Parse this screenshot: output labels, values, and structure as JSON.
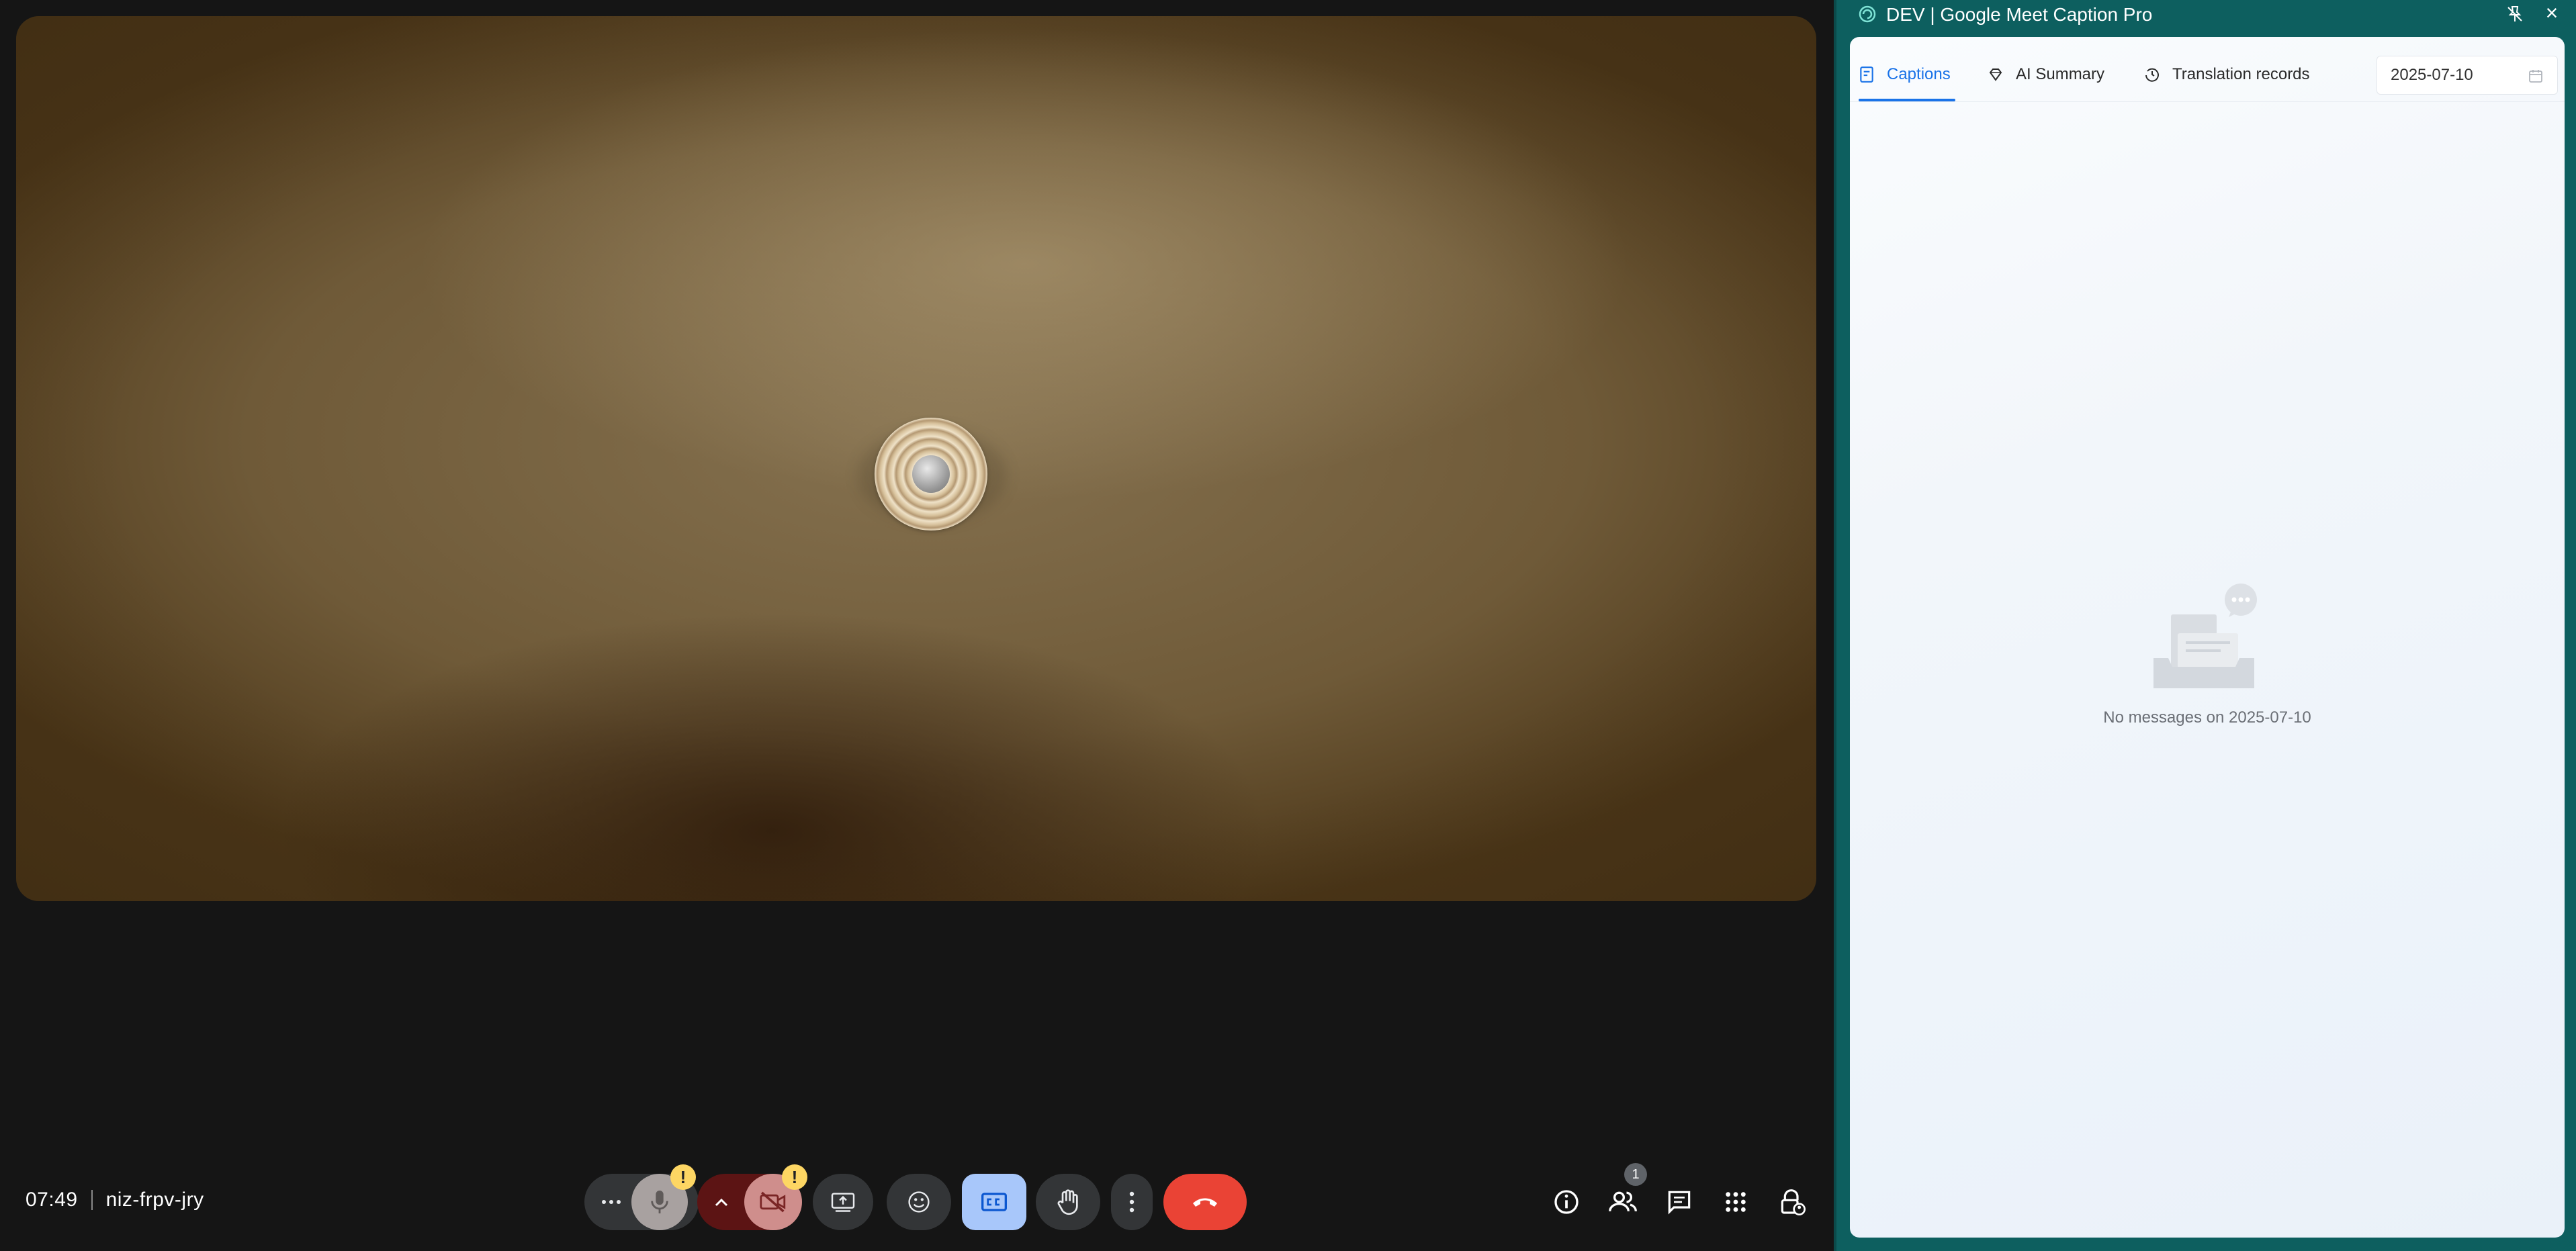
{
  "meet": {
    "time": "07:49",
    "meeting_code": "niz-frpv-jry",
    "people_count": "1",
    "warning_glyph": "!",
    "controls": [
      {
        "name": "more-options-icon"
      },
      {
        "name": "microphone-muted-icon"
      },
      {
        "name": "chevron-up-icon"
      },
      {
        "name": "camera-off-icon"
      },
      {
        "name": "present-screen-icon"
      },
      {
        "name": "emoji-reaction-icon"
      },
      {
        "name": "captions-icon"
      },
      {
        "name": "raise-hand-icon"
      },
      {
        "name": "more-vert-icon"
      },
      {
        "name": "end-call-icon"
      }
    ],
    "colors": {
      "end_call": "#ea4335",
      "captions_active": "#a8c7fa",
      "warning": "#fdd663"
    }
  },
  "extension": {
    "window_title": "DEV | Google Meet Caption Pro",
    "close_glyph": "×",
    "tabs": [
      {
        "label": "Captions",
        "active": true,
        "icon": "captions-doc-icon"
      },
      {
        "label": "AI Summary",
        "active": false,
        "icon": "diamond-icon"
      },
      {
        "label": "Translation records",
        "active": false,
        "icon": "history-icon"
      }
    ],
    "date_value": "2025-07-10",
    "empty_message": "No messages on 2025-07-10",
    "colors": {
      "accent": "#1a73e8",
      "frame": "#0d5f5f"
    }
  }
}
